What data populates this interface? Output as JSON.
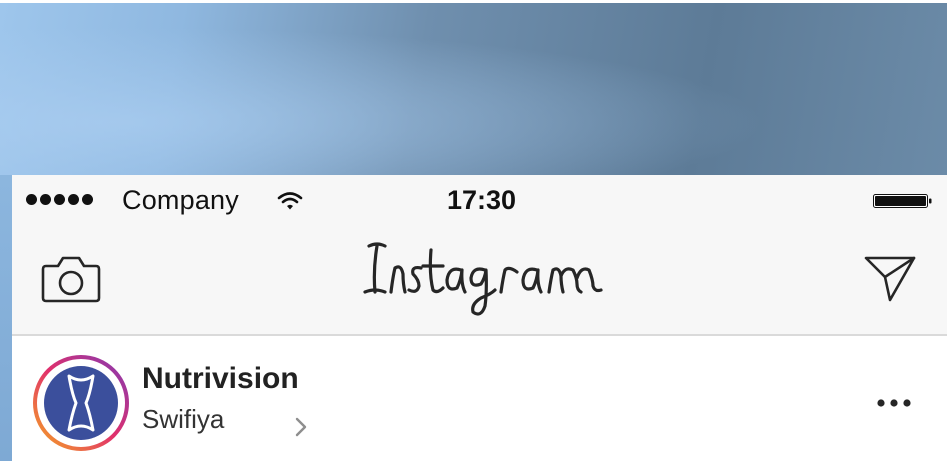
{
  "status_bar": {
    "signal_dots": 5,
    "carrier": "Company",
    "wifi_icon": "wifi-icon",
    "time": "17:30",
    "battery_icon": "battery-full-icon",
    "battery_level": 1.0
  },
  "nav_bar": {
    "left_icon": "camera-icon",
    "logo_text": "Instagram",
    "right_icon": "direct-send-icon"
  },
  "post": {
    "account_name": "Nutrivision",
    "location": "Swifiya",
    "location_chevron_icon": "chevron-right-icon",
    "more_icon": "more-dots-icon",
    "avatar_ring_colors": [
      "#f5a623",
      "#e1306c",
      "#833ab4"
    ],
    "avatar_fill_color": "#3b4f9c"
  }
}
